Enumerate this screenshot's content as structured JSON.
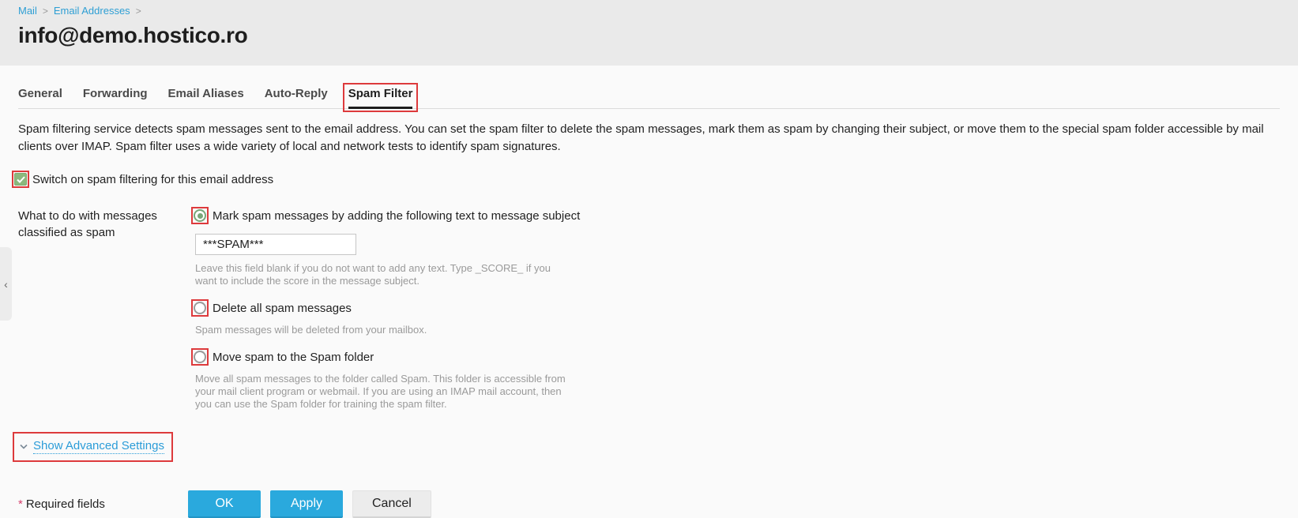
{
  "colors": {
    "annotation_red": "#dd3a3c",
    "accent_blue": "#2aa9dd",
    "checkbox_green": "#8cb87d"
  },
  "breadcrumb": {
    "items": [
      {
        "label": "Mail"
      },
      {
        "label": "Email Addresses"
      }
    ],
    "separator": ">"
  },
  "page": {
    "title": "info@demo.hostico.ro"
  },
  "tabs": [
    {
      "label": "General",
      "active": false
    },
    {
      "label": "Forwarding",
      "active": false
    },
    {
      "label": "Email Aliases",
      "active": false
    },
    {
      "label": "Auto-Reply",
      "active": false
    },
    {
      "label": "Spam Filter",
      "active": true,
      "annotated": true
    }
  ],
  "description": "Spam filtering service detects spam messages sent to the email address. You can set the spam filter to delete the spam messages, mark them as spam by changing their subject, or move them to the special spam folder accessible by mail clients over IMAP. Spam filter uses a wide variety of local and network tests to identify spam signatures.",
  "spam_switch": {
    "label": "Switch on spam filtering for this email address",
    "checked": true,
    "annotated": true
  },
  "form": {
    "group_label": "What to do with messages classified as spam",
    "options": [
      {
        "label": "Mark spam messages by adding the following text to message subject",
        "selected": true,
        "annotated": true,
        "input_value": "***SPAM***",
        "help": "Leave this field blank if you do not want to add any text. Type _SCORE_ if you want to include the score in the message subject."
      },
      {
        "label": "Delete all spam messages",
        "selected": false,
        "annotated": true,
        "help": "Spam messages will be deleted from your mailbox."
      },
      {
        "label": "Move spam to the Spam folder",
        "selected": false,
        "annotated": true,
        "help": "Move all spam messages to the folder called Spam. This folder is accessible from your mail client program or webmail. If you are using an IMAP mail account, then you can use the Spam folder for training the spam filter."
      }
    ]
  },
  "advanced": {
    "label": "Show Advanced Settings",
    "annotated": true
  },
  "footer": {
    "asterisk": "*",
    "required_note": "Required fields",
    "buttons": [
      {
        "label": "OK",
        "style": "primary"
      },
      {
        "label": "Apply",
        "style": "primary"
      },
      {
        "label": "Cancel",
        "style": "default"
      }
    ]
  },
  "icons": {
    "collapse_chevron": "‹"
  }
}
